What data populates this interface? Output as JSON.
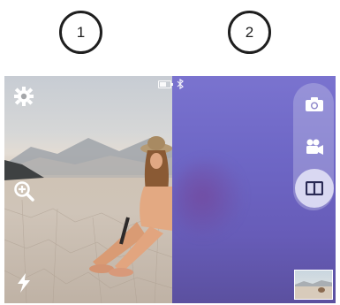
{
  "steps": [
    {
      "label": "1"
    },
    {
      "label": "2"
    }
  ],
  "status": {
    "battery_level": 0.6,
    "icons": [
      "battery-icon",
      "bluetooth-icon"
    ]
  },
  "left_controls": [
    "gear-icon",
    "zoom-in-icon",
    "flash-icon"
  ],
  "mode_selector": {
    "modes": [
      "camera-icon",
      "video-camera-icon",
      "split-view-icon"
    ],
    "active": "split-view-icon"
  },
  "colors": {
    "right_panel_tint": "#6e67c6",
    "icon_white": "#ffffff",
    "step_border": "#1f1f1f"
  }
}
